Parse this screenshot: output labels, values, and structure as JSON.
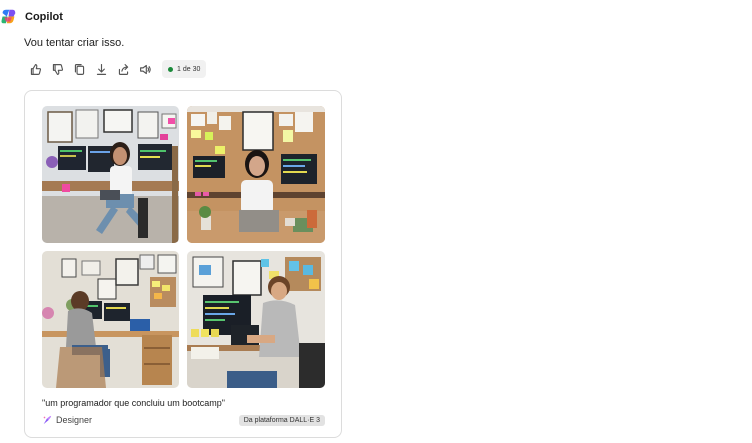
{
  "app": {
    "name": "Copilot",
    "logo_icon": "copilot-logo-icon"
  },
  "message": {
    "text": "Vou tentar criar isso."
  },
  "actions": [
    {
      "name": "thumbs-up-icon"
    },
    {
      "name": "thumbs-down-icon"
    },
    {
      "name": "copy-icon"
    },
    {
      "name": "download-icon"
    },
    {
      "name": "share-icon"
    },
    {
      "name": "speaker-icon"
    }
  ],
  "counter": {
    "label": "1 de 30",
    "status_color": "#1a8a3a"
  },
  "card": {
    "images": [
      {
        "name": "generated-image-1"
      },
      {
        "name": "generated-image-2"
      },
      {
        "name": "generated-image-3"
      },
      {
        "name": "generated-image-4"
      }
    ],
    "caption": "\"um programador que concluiu um bootcamp\"",
    "source": "Designer",
    "badge": "Da plataforma DALL·E 3"
  }
}
